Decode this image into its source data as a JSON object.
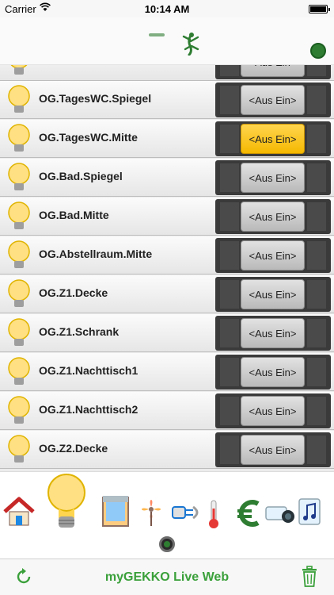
{
  "status_bar": {
    "carrier": "Carrier",
    "time": "10:14 AM"
  },
  "list": {
    "rows": [
      {
        "label": "",
        "button": "<Aus Ein>",
        "state": "off"
      },
      {
        "label": "OG.TagesWC.Spiegel",
        "button": "<Aus Ein>",
        "state": "off"
      },
      {
        "label": "OG.TagesWC.Mitte",
        "button": "<Aus Ein>",
        "state": "on"
      },
      {
        "label": "OG.Bad.Spiegel",
        "button": "<Aus Ein>",
        "state": "off"
      },
      {
        "label": "OG.Bad.Mitte",
        "button": "<Aus Ein>",
        "state": "off"
      },
      {
        "label": "OG.Abstellraum.Mitte",
        "button": "<Aus Ein>",
        "state": "off"
      },
      {
        "label": "OG.Z1.Decke",
        "button": "<Aus Ein>",
        "state": "off"
      },
      {
        "label": "OG.Z1.Schrank",
        "button": "<Aus Ein>",
        "state": "off"
      },
      {
        "label": "OG.Z1.Nachttisch1",
        "button": "<Aus Ein>",
        "state": "off"
      },
      {
        "label": "OG.Z1.Nachttisch2",
        "button": "<Aus Ein>",
        "state": "off"
      },
      {
        "label": "OG.Z2.Decke",
        "button": "<Aus Ein>",
        "state": "off"
      }
    ]
  },
  "icon_bar": {
    "icons": [
      "house-icon",
      "lightbulb-icon",
      "window-blind-icon",
      "fan-icon",
      "power-plug-icon",
      "thermometer-icon",
      "euro-icon",
      "camera-icon",
      "music-icon"
    ]
  },
  "bottom_bar": {
    "title": "myGEKKO Live Web"
  },
  "colors": {
    "accent_green": "#3aa03a",
    "toggle_on": "#f5b800"
  }
}
